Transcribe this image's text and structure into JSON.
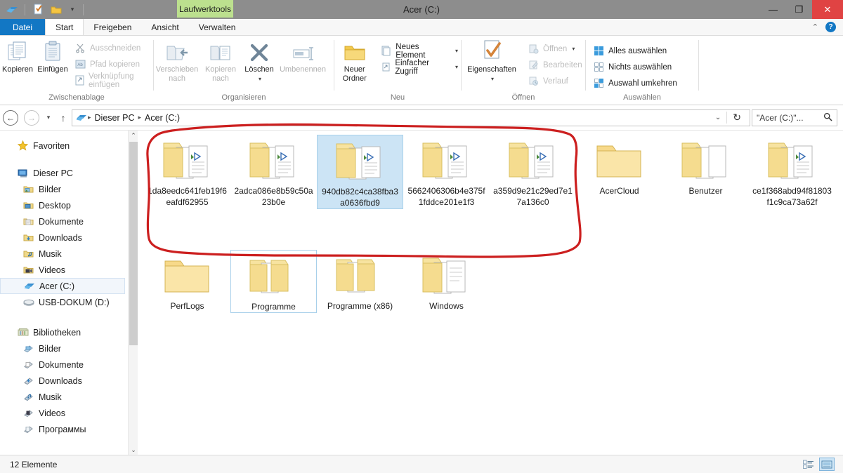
{
  "window": {
    "title": "Acer (C:)",
    "contextual_tab": "Laufwerktools",
    "minimize": "—",
    "restore": "❐",
    "close": "✕"
  },
  "quick_access": {
    "items": [
      {
        "name": "explorer-icon",
        "glyph": "drive"
      },
      {
        "name": "properties-icon",
        "glyph": "props"
      },
      {
        "name": "new-folder-icon",
        "glyph": "folder"
      }
    ],
    "caret": "▾"
  },
  "ribbon_tabs": {
    "file": "Datei",
    "items": [
      "Start",
      "Freigeben",
      "Ansicht",
      "Verwalten"
    ],
    "active": "Start",
    "collapse_caret": "⌃",
    "help": "?"
  },
  "ribbon": {
    "groups": [
      {
        "label": "Zwischenablage",
        "big": [
          {
            "label": "Kopieren",
            "icon": "copy-icon",
            "disabled": false
          },
          {
            "label": "Einfügen",
            "icon": "paste-icon",
            "disabled": false
          }
        ],
        "small": [
          {
            "label": "Ausschneiden",
            "icon": "scissors-icon",
            "disabled": true
          },
          {
            "label": "Pfad kopieren",
            "icon": "copy-path-icon",
            "disabled": true
          },
          {
            "label": "Verknüpfung einfügen",
            "icon": "paste-shortcut-icon",
            "disabled": true
          }
        ]
      },
      {
        "label": "Organisieren",
        "big": [
          {
            "label": "Verschieben nach",
            "icon": "move-to-icon",
            "disabled": true,
            "dropdown": true
          },
          {
            "label": "Kopieren nach",
            "icon": "copy-to-icon",
            "disabled": true,
            "dropdown": true
          },
          {
            "label": "Löschen",
            "icon": "delete-icon",
            "disabled": false,
            "dropdown": true
          },
          {
            "label": "Umbenennen",
            "icon": "rename-icon",
            "disabled": true
          }
        ],
        "small": []
      },
      {
        "label": "Neu",
        "big": [
          {
            "label": "Neuer Ordner",
            "icon": "new-folder-icon",
            "disabled": false
          }
        ],
        "small": [
          {
            "label": "Neues Element",
            "icon": "new-item-icon",
            "disabled": false,
            "dropdown": true
          },
          {
            "label": "Einfacher Zugriff",
            "icon": "easy-access-icon",
            "disabled": false,
            "dropdown": true
          }
        ]
      },
      {
        "label": "Öffnen",
        "big": [
          {
            "label": "Eigenschaften",
            "icon": "properties-icon",
            "disabled": false,
            "dropdown": true
          }
        ],
        "small": [
          {
            "label": "Öffnen",
            "icon": "open-icon",
            "disabled": true,
            "dropdown": true
          },
          {
            "label": "Bearbeiten",
            "icon": "edit-icon",
            "disabled": true
          },
          {
            "label": "Verlauf",
            "icon": "history-icon",
            "disabled": true
          }
        ]
      },
      {
        "label": "Auswählen",
        "big": [],
        "small": [
          {
            "label": "Alles auswählen",
            "icon": "select-all-icon",
            "disabled": false
          },
          {
            "label": "Nichts auswählen",
            "icon": "select-none-icon",
            "disabled": false
          },
          {
            "label": "Auswahl umkehren",
            "icon": "invert-selection-icon",
            "disabled": false
          }
        ]
      }
    ]
  },
  "addressbar": {
    "back": "←",
    "forward": "→",
    "history_caret": "▾",
    "up": "↑",
    "breadcrumbs": [
      "Dieser PC",
      "Acer (C:)"
    ],
    "separator": "▸",
    "dropdown_caret": "⌄",
    "refresh": "↻",
    "search_value": "\"Acer (C:)\"...",
    "search_icon": "⌕"
  },
  "navigation_pane": {
    "sections": [
      {
        "header": {
          "label": "Favoriten",
          "icon": "star-icon",
          "selected": false
        },
        "children": []
      },
      {
        "header": {
          "label": "Dieser PC",
          "icon": "computer-icon",
          "selected": false
        },
        "children": [
          {
            "label": "Bilder",
            "icon": "pictures-folder-icon",
            "selected": false
          },
          {
            "label": "Desktop",
            "icon": "desktop-folder-icon",
            "selected": false
          },
          {
            "label": "Dokumente",
            "icon": "documents-folder-icon",
            "selected": false
          },
          {
            "label": "Downloads",
            "icon": "downloads-folder-icon",
            "selected": false
          },
          {
            "label": "Musik",
            "icon": "music-folder-icon",
            "selected": false
          },
          {
            "label": "Videos",
            "icon": "videos-folder-icon",
            "selected": false
          },
          {
            "label": "Acer (C:)",
            "icon": "hard-drive-icon",
            "selected": true
          },
          {
            "label": "USB-DOKUM (D:)",
            "icon": "usb-drive-icon",
            "selected": false
          }
        ]
      },
      {
        "header": {
          "label": "Bibliotheken",
          "icon": "libraries-icon",
          "selected": false
        },
        "children": [
          {
            "label": "Bilder",
            "icon": "library-pictures-icon",
            "selected": false
          },
          {
            "label": "Dokumente",
            "icon": "library-documents-icon",
            "selected": false
          },
          {
            "label": "Downloads",
            "icon": "library-downloads-icon",
            "selected": false
          },
          {
            "label": "Musik",
            "icon": "library-music-icon",
            "selected": false
          },
          {
            "label": "Videos",
            "icon": "library-videos-icon",
            "selected": false
          },
          {
            "label": "Программы",
            "icon": "library-programs-icon",
            "selected": false
          }
        ]
      }
    ],
    "scroll_up": "⌃",
    "scroll_down": "⌄"
  },
  "files": {
    "row1": [
      {
        "name": "1da8eedc641feb19f6eafdf62955",
        "state": "normal",
        "circled": true
      },
      {
        "name": "2adca086e8b59c50a23b0e",
        "state": "normal",
        "circled": true
      },
      {
        "name": "940db82c4ca38fba3a0636fbd9",
        "state": "selected",
        "circled": true
      },
      {
        "name": "5662406306b4e375f1fddce201e1f3",
        "state": "normal",
        "circled": true
      },
      {
        "name": "a359d9e21c29ed7e17a136c0",
        "state": "normal",
        "circled": true
      },
      {
        "name": "AcerCloud",
        "state": "normal",
        "circled": false
      },
      {
        "name": "Benutzer",
        "state": "normal",
        "circled": false
      },
      {
        "name": "ce1f368abd94f81803f1c9ca73a62f",
        "state": "normal",
        "circled": false
      }
    ],
    "row2": [
      {
        "name": "PerfLogs",
        "state": "normal",
        "circled": false
      },
      {
        "name": "Programme",
        "state": "focused",
        "circled": false
      },
      {
        "name": "Programme (x86)",
        "state": "normal",
        "circled": false
      },
      {
        "name": "Windows",
        "state": "normal",
        "circled": false
      }
    ]
  },
  "statusbar": {
    "item_count": "12 Elemente",
    "view_details_icon": "details-view-icon",
    "view_large_icon": "large-icons-view-icon"
  },
  "annotation": {
    "name": "red-hand-drawn-oval",
    "color": "#cc1f1f"
  }
}
